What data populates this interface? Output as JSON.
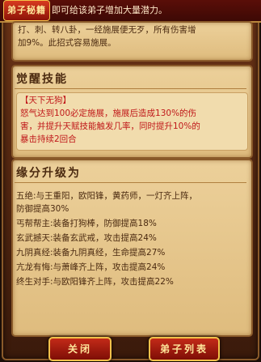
{
  "banner": {
    "badge": "弟子秘籍",
    "text": "即可给该弟子增加大量潜力。"
  },
  "intro": {
    "line1": "打、刺、转八卦，一经施展便无歹，所有伤害增",
    "line2": "加9%。此招式容易施展。"
  },
  "awakening": {
    "title": "觉醒技能",
    "skill_name": "【天下无狗】",
    "line1": "怒气达到100必定施展，施展后造成130%的伤",
    "line2": "害，并提升天赋技能触发几率，同时提升10%的",
    "line3": "暴击持续2回合"
  },
  "fate": {
    "title": "缘分升级为",
    "rows": [
      {
        "text": "五绝:与王重阳，欧阳锋，黄药师，一灯齐上阵，"
      },
      {
        "text": "防御提高30%"
      },
      {
        "text": "丐帮帮主:装备打狗棒，防御提高18%"
      },
      {
        "text": "玄武撼天:装备玄武戒，攻击提高24%"
      },
      {
        "text": "九阴真经:装备九阴真经，生命提高27%"
      },
      {
        "text": "亢龙有悔:与萧峰齐上阵，攻击提高24%"
      },
      {
        "text": "终生对手:与欧阳锋齐上阵，攻击提高22%"
      }
    ]
  },
  "buttons": {
    "close": "关闭",
    "disciple_list": "弟子列表"
  }
}
